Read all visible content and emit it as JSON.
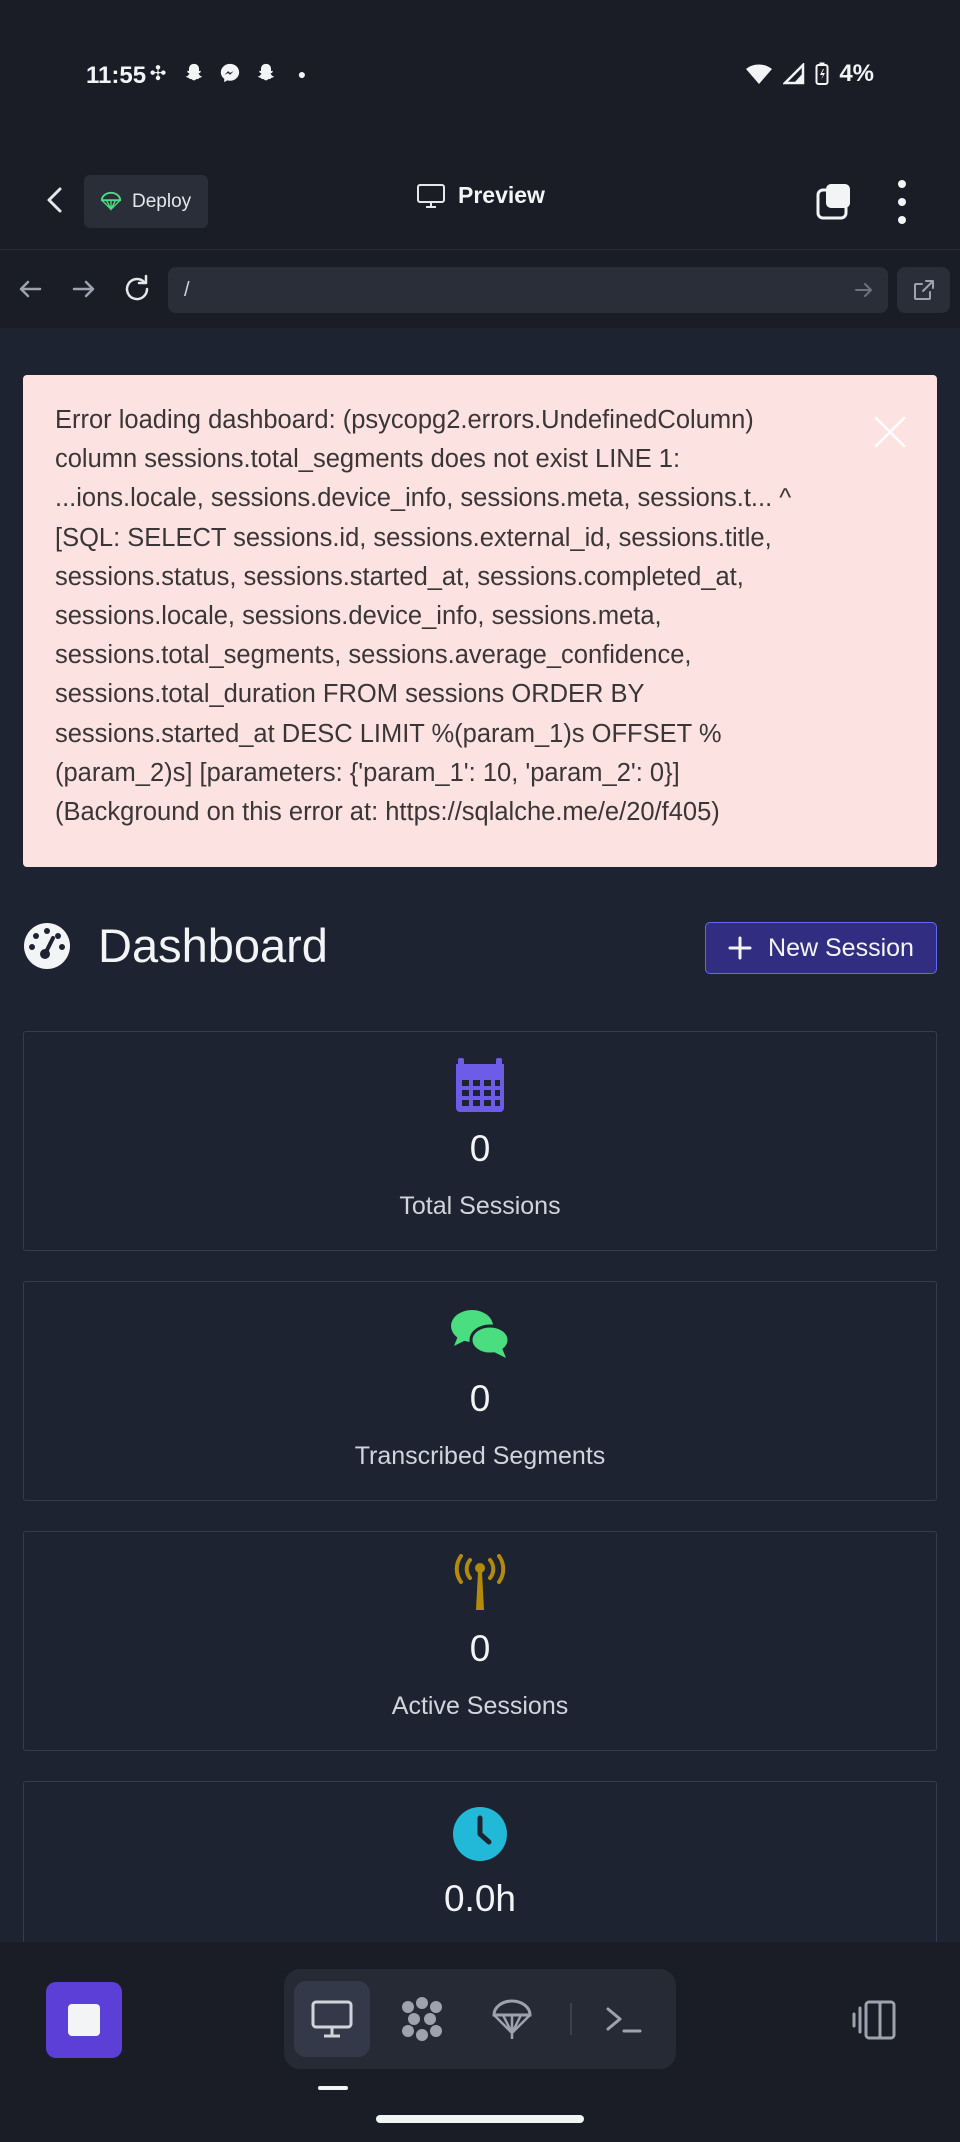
{
  "status_bar": {
    "time": "11:55",
    "notification_icons": [
      "slack-icon",
      "snapchat-icon",
      "messenger-icon",
      "snapchat-icon",
      "dot-icon"
    ],
    "battery": "4%"
  },
  "app_bar": {
    "deploy_label": "Deploy",
    "title": "Preview"
  },
  "url_bar": {
    "value": "/"
  },
  "error_alert": {
    "lines": [
      "Error loading dashboard: (psycopg2.errors.UndefinedColumn)",
      "column sessions.total_segments does not exist LINE 1:",
      "...ions.locale, sessions.device_info, sessions.meta, sessions.t... ^",
      "[SQL: SELECT sessions.id, sessions.external_id, sessions.title,",
      "sessions.status, sessions.started_at, sessions.completed_at,",
      "sessions.locale, sessions.device_info, sessions.meta,",
      "sessions.total_segments, sessions.average_confidence,",
      "sessions.total_duration FROM sessions ORDER BY",
      "sessions.started_at DESC LIMIT %(param_1)s OFFSET %",
      "(param_2)s] [parameters: {'param_1': 10, 'param_2': 0}]",
      "(Background on this error at: https://sqlalche.me/e/20/f405)"
    ]
  },
  "dashboard": {
    "title": "Dashboard",
    "new_session_label": "New Session"
  },
  "stats": [
    {
      "icon": "calendar-icon",
      "value": "0",
      "label": "Total Sessions",
      "color": "#6d5ce8"
    },
    {
      "icon": "comments-icon",
      "value": "0",
      "label": "Transcribed Segments",
      "color": "#4ade80"
    },
    {
      "icon": "broadcast-tower-icon",
      "value": "0",
      "label": "Active Sessions",
      "color": "#b48a0a"
    },
    {
      "icon": "clock-icon",
      "value": "0.0h",
      "label": "",
      "color": "#22b8d8"
    }
  ],
  "colors": {
    "background": "#111827",
    "content_bg": "#1e2331",
    "alert_bg": "#fde2e2",
    "accent": "#5b3fd6"
  }
}
